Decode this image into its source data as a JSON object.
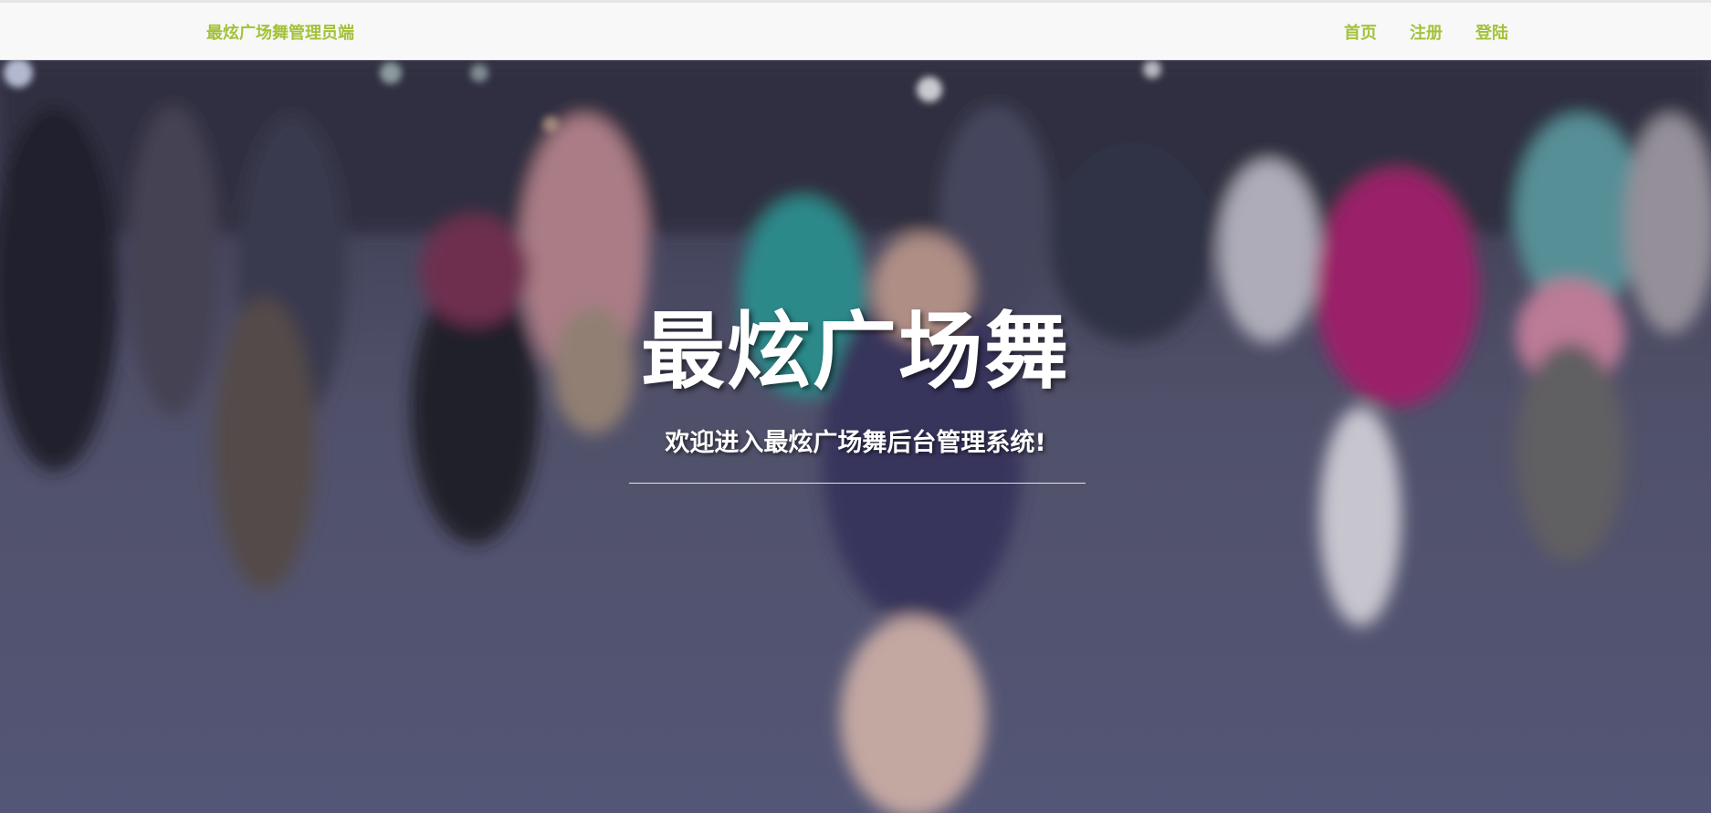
{
  "header": {
    "brand": "最炫广场舞管理员端",
    "nav": [
      {
        "label": "首页"
      },
      {
        "label": "注册"
      },
      {
        "label": "登陆"
      }
    ]
  },
  "hero": {
    "title": "最炫广场舞",
    "subtitle": "欢迎进入最炫广场舞后台管理系统!"
  },
  "colors": {
    "accent": "#a3c23a",
    "navbar_bg": "#f8f8f8",
    "hero_overlay": "#4a4a63"
  }
}
